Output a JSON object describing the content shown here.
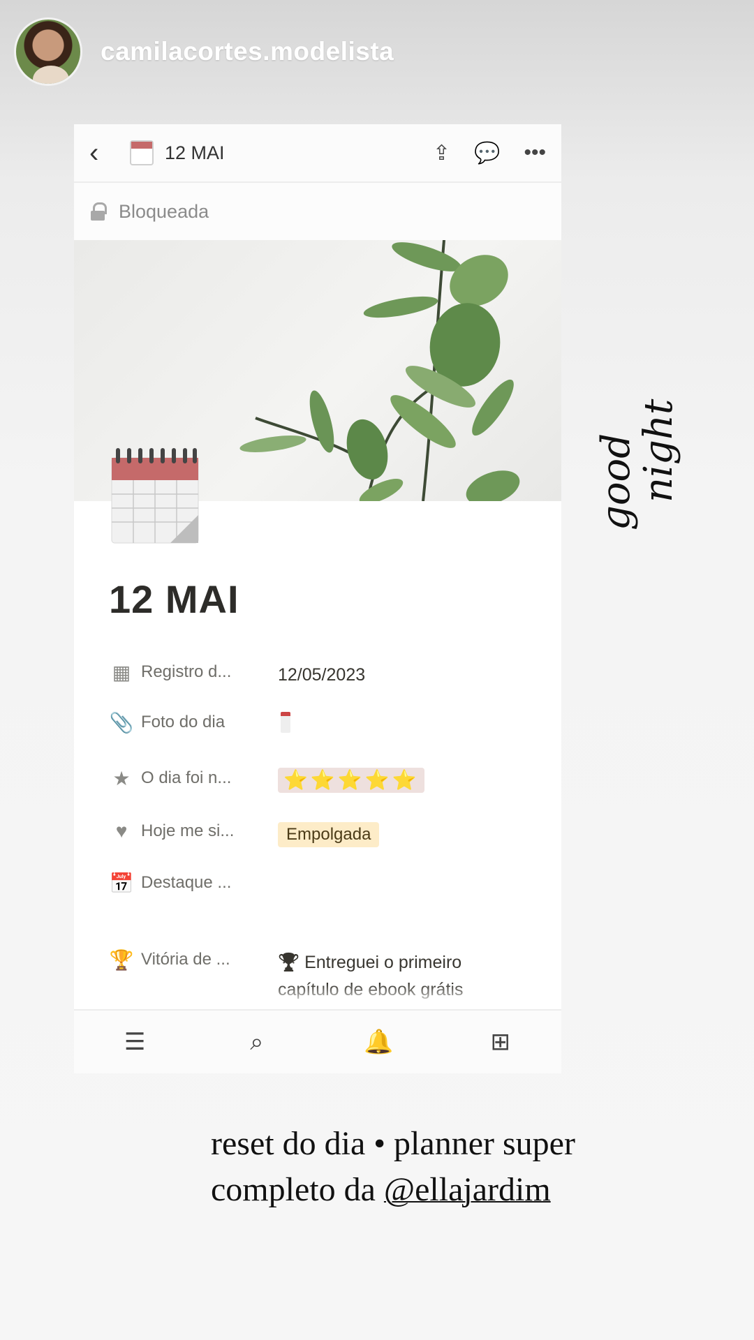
{
  "story": {
    "username": "camilacortes.modelista"
  },
  "topbar": {
    "title": "12 MAI"
  },
  "lockbar": {
    "label": "Bloqueada"
  },
  "page": {
    "title": "12 MAI"
  },
  "properties": [
    {
      "key": "Registro d...",
      "icon": "calendar-grid-icon",
      "value": "12/05/2023"
    },
    {
      "key": "Foto do dia",
      "icon": "paperclip-icon",
      "value": ""
    },
    {
      "key": "O dia foi n...",
      "icon": "star-icon",
      "value": "⭐⭐⭐⭐⭐",
      "rating": 5
    },
    {
      "key": "Hoje me si...",
      "icon": "heart-icon",
      "value": "Empolgada"
    },
    {
      "key": "Destaque ...",
      "icon": "calendar-icon",
      "value": ""
    },
    {
      "key": "Vitória de ...",
      "icon": "trophy-icon",
      "value": "🏆 Entreguei o primeiro capítulo de ebook grátis para audiência"
    }
  ],
  "bottom_nav": [
    "list-icon",
    "search-icon",
    "bell-icon",
    "add-icon"
  ],
  "handwriting": {
    "line1": "good",
    "line2": "night"
  },
  "caption": {
    "line1": "reset do dia • planner super",
    "line2_prefix": "completo da ",
    "mention": "@ellajardim"
  },
  "colors": {
    "tag_bg": "#fdecc8",
    "stars_bg": "#eee0de",
    "calendar_red": "#c56a6a",
    "leaf_green": "#5f8a4c"
  }
}
